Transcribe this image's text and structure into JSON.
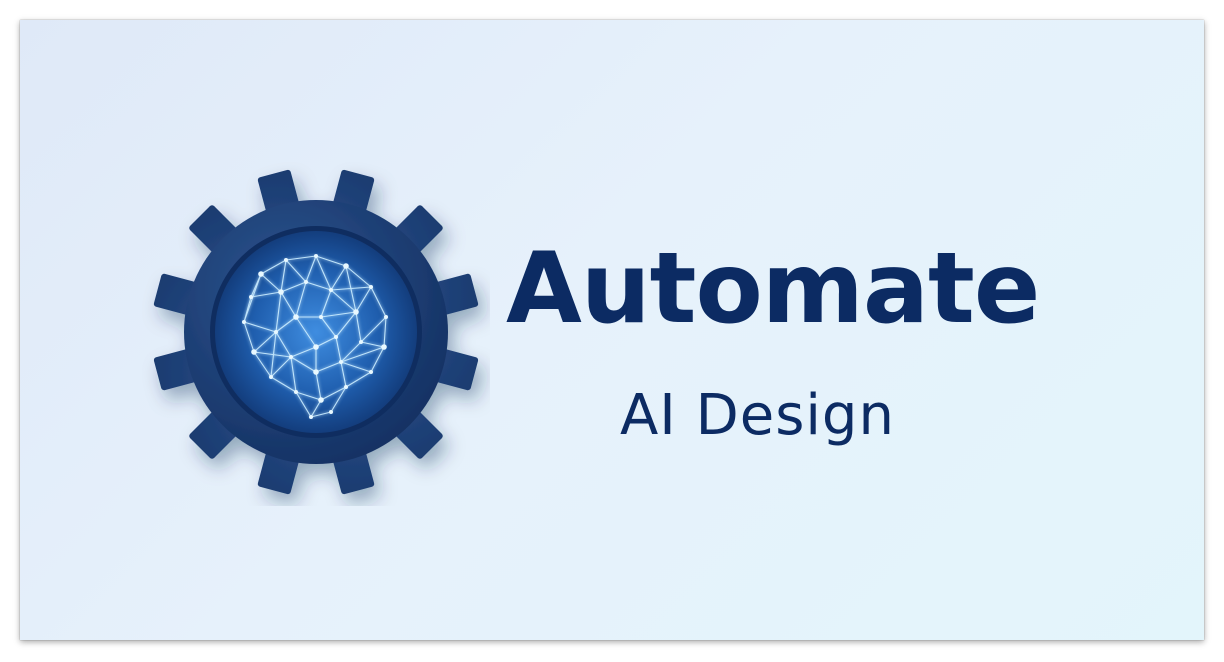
{
  "logo": {
    "title": "Automate",
    "subtitle": "AI Design",
    "icon": "gear-brain-network-icon"
  },
  "colors": {
    "background": "#e3eefa",
    "text": "#0c2b63",
    "gear": "#1c3f78",
    "gear_inner": "#1e5aa6",
    "network_glow": "#bfe6ff"
  }
}
